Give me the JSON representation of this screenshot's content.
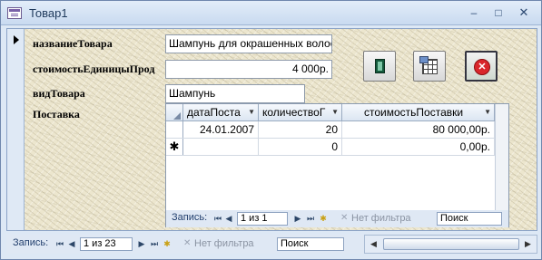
{
  "window": {
    "title": "Товар1"
  },
  "form": {
    "fields": [
      {
        "label": "названиеТовара",
        "value": "Шампунь для окрашенных волос"
      },
      {
        "label": "стоимостьЕдиницыПрод",
        "value": "4 000р."
      },
      {
        "label": "видТовара",
        "value": "Шампунь"
      }
    ],
    "subform_label": "Поставка"
  },
  "subform": {
    "columns": [
      "датаПоста",
      "количествоГ",
      "стоимостьПоставки"
    ],
    "rows": [
      {
        "selector": "",
        "cells": [
          "24.01.2007",
          "20",
          "80 000,00р."
        ]
      },
      {
        "selector": "✱",
        "cells": [
          "",
          "0",
          "0,00р."
        ]
      }
    ],
    "nav": {
      "label": "Запись:",
      "position": "1 из 1",
      "filter": "Нет фильтра",
      "search": "Поиск"
    }
  },
  "nav": {
    "label": "Запись:",
    "position": "1 из 23",
    "filter": "Нет фильтра",
    "search": "Поиск"
  },
  "icons": {
    "window_icon": "form-icon",
    "button1": "book-icon",
    "button2": "grid-window-icon",
    "button3": "close-red-icon"
  },
  "colors": {
    "form_background": "#ece6ce",
    "close_accent": "#d9262b"
  }
}
